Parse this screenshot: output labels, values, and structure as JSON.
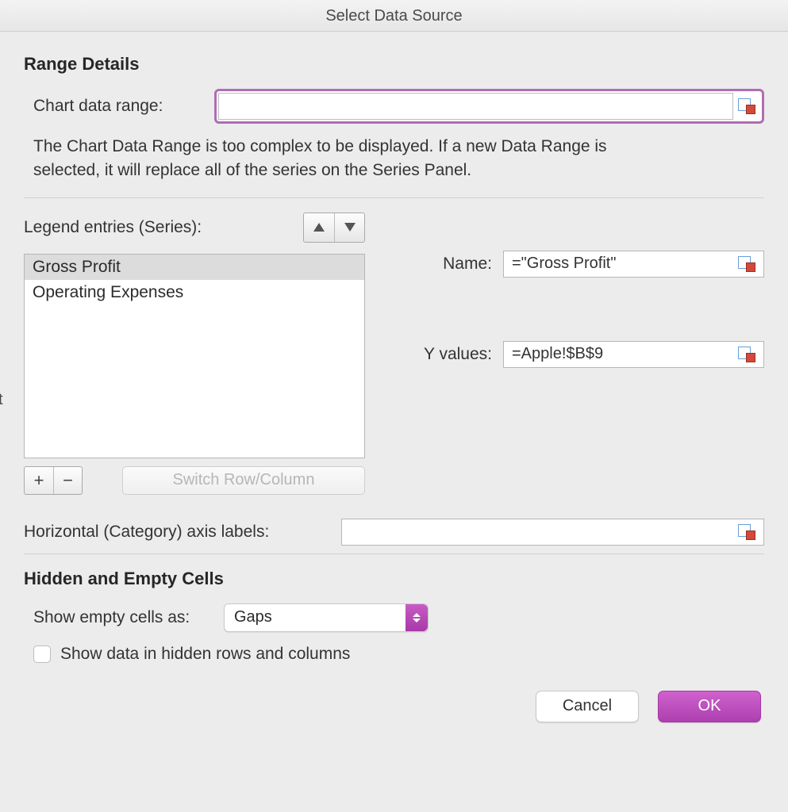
{
  "title": "Select Data Source",
  "range_details": {
    "heading": "Range Details",
    "chart_data_range_label": "Chart data range:",
    "chart_data_range_value": "",
    "help_text": "The Chart Data Range is too complex to be displayed. If a new Data Range is selected, it will replace all of the series on the Series Panel."
  },
  "legend": {
    "label": "Legend entries (Series):",
    "series": [
      "Gross Profit",
      "Operating Expenses"
    ],
    "selected_index": 0,
    "switch_label": "Switch Row/Column"
  },
  "series_form": {
    "name_label": "Name:",
    "name_value": "=\"Gross Profit\"",
    "yvalues_label": "Y values:",
    "yvalues_value": "=Apple!$B$9"
  },
  "haxis": {
    "label": "Horizontal (Category) axis labels:",
    "value": ""
  },
  "hidden_empty": {
    "heading": "Hidden and Empty Cells",
    "show_empty_label": "Show empty cells as:",
    "show_empty_value": "Gaps",
    "show_hidden_label": "Show data in hidden rows and columns",
    "show_hidden_checked": false
  },
  "footer": {
    "cancel": "Cancel",
    "ok": "OK"
  },
  "truncated_edge_char": "t"
}
